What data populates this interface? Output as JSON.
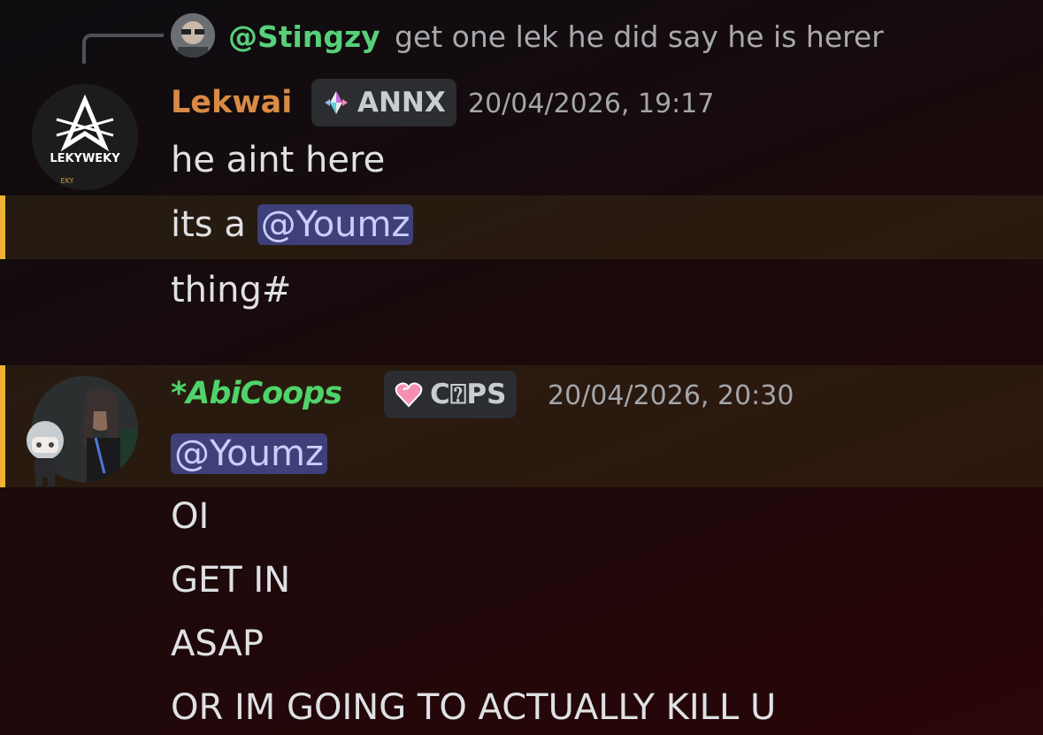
{
  "reply": {
    "username": "@Stingzy",
    "text": "get one lek he did say he is herer"
  },
  "messages": [
    {
      "username": "Lekwai",
      "tag": "ANNX",
      "timestamp": "20/04/2026, 19:17",
      "avatar_text": "LEKYWEKY",
      "avatar_subtext": "EKY",
      "lines": [
        "he aint here",
        "its a ",
        "thing#"
      ],
      "mention": "@Youmz"
    },
    {
      "username": "*AbiCoops",
      "tag": "C⍰PS",
      "timestamp": "20/04/2026, 20:30",
      "mention": "@Youmz",
      "lines": [
        "OI",
        "GET IN",
        "ASAP",
        "OR IM GOING TO ACTUALLY KILL U"
      ]
    }
  ],
  "colors": {
    "highlight_border": "#f0b232",
    "mention_bg": "#3f3f7a",
    "username1": "#d98a44",
    "username2": "#4fd46a",
    "reply_name": "#57d07a"
  }
}
